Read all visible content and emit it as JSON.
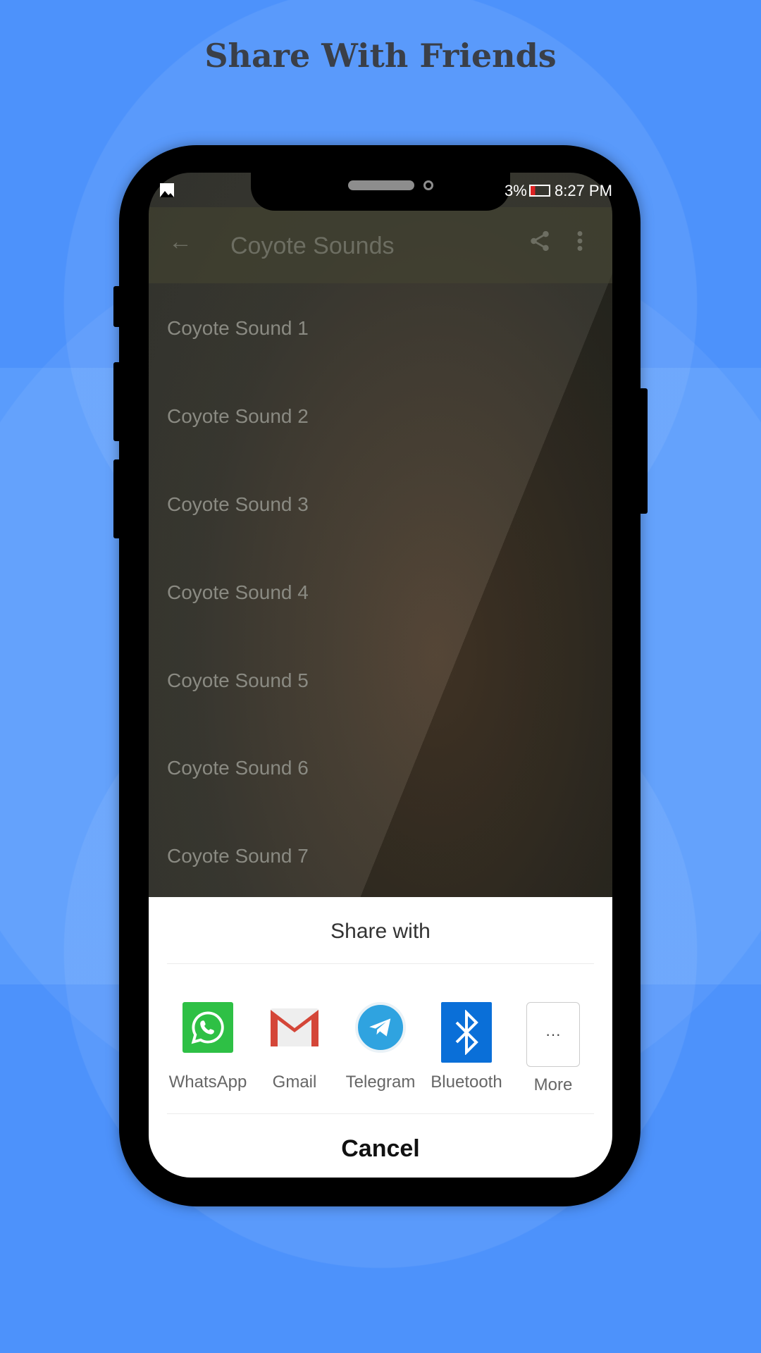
{
  "promo_title": "Share With Friends",
  "status_bar": {
    "battery": "3%",
    "time": "8:27 PM"
  },
  "app_bar": {
    "title": "Coyote Sounds",
    "back_icon": "arrow-left-icon",
    "share_icon": "share-icon",
    "menu_icon": "more-vert-icon"
  },
  "list": [
    "Coyote Sound 1",
    "Coyote Sound 2",
    "Coyote Sound 3",
    "Coyote Sound 4",
    "Coyote Sound 5",
    "Coyote Sound 6",
    "Coyote Sound 7"
  ],
  "share_sheet": {
    "title": "Share with",
    "targets": [
      {
        "label": "WhatsApp",
        "color": "#2ec045"
      },
      {
        "label": "Gmail",
        "color": "#d44638"
      },
      {
        "label": "Telegram",
        "color": "#2fa3e0"
      },
      {
        "label": "Bluetooth",
        "color": "#0a6fd8"
      },
      {
        "label": "More",
        "color": "#ffffff"
      }
    ],
    "cancel": "Cancel"
  }
}
